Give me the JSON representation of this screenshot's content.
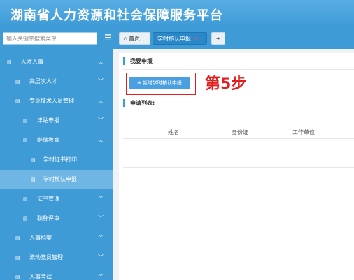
{
  "header": {
    "title": "湖南省人力资源和社会保障服务平台"
  },
  "topbar": {
    "search_placeholder": "输入关键字搜索菜单",
    "menu_toggle": "☰",
    "tabs": [
      {
        "label": "首页",
        "icon": "home-icon"
      },
      {
        "label": "学时核认申报",
        "close": "×"
      },
      {
        "label": "+"
      }
    ]
  },
  "sidebar": {
    "items": [
      {
        "label": "人才人事",
        "icon": "▤",
        "chev": "︿"
      },
      {
        "label": "高层次人才",
        "icon": "▤",
        "chev": "﹀"
      },
      {
        "label": "专业技术人员管理",
        "icon": "▤",
        "chev": "︿"
      },
      {
        "label": "津贴申报",
        "icon": "▤",
        "chev": "﹀"
      },
      {
        "label": "继续教育",
        "icon": "▤",
        "chev": "︿"
      },
      {
        "label": "学时证书打印",
        "icon": "▤"
      },
      {
        "label": "学时核认申报",
        "icon": "▤"
      },
      {
        "label": "证书管理",
        "icon": "▤",
        "chev": "﹀"
      },
      {
        "label": "职称评审",
        "icon": "▤",
        "chev": "﹀"
      },
      {
        "label": "人事档案",
        "icon": "▤",
        "chev": "﹀"
      },
      {
        "label": "流动党员管理",
        "icon": "▤",
        "chev": "﹀"
      },
      {
        "label": "人事考试",
        "icon": "▤",
        "chev": "﹀"
      }
    ]
  },
  "main": {
    "section1_title": "我要申报",
    "new_button_label": "新增学时核认申报",
    "plus_icon": "⊕",
    "step_label": "第5步",
    "section2_title": "申请列表:",
    "table_headers": [
      "姓名",
      "身份证",
      "工作单位"
    ]
  },
  "colors": {
    "header_blue": "#3d9ad6",
    "sidebar_blue": "#3f9bd5",
    "active_item": "#6fb6e4",
    "annotation_red": "#e02020"
  }
}
